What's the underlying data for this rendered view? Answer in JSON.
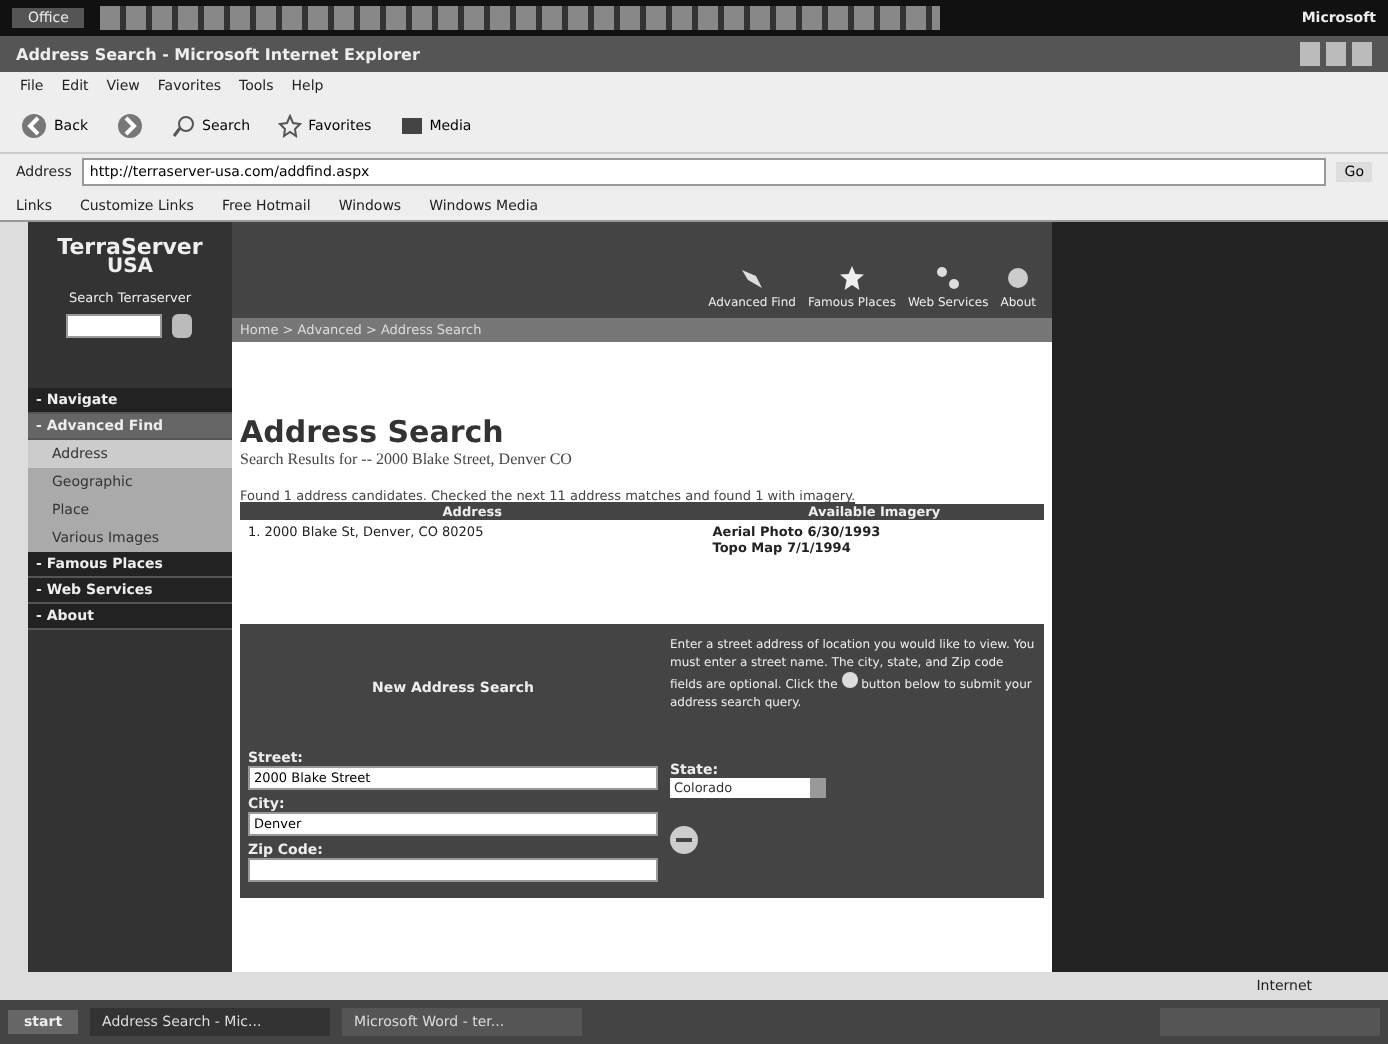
{
  "office_bar": {
    "label": "Office",
    "brand": "Microsoft"
  },
  "window": {
    "title": "Address Search - Microsoft Internet Explorer"
  },
  "menu": [
    "File",
    "Edit",
    "View",
    "Favorites",
    "Tools",
    "Help"
  ],
  "toolbar": [
    {
      "kind": "back",
      "label": "Back"
    },
    {
      "kind": "forward"
    },
    {
      "kind": "search",
      "label": "Search"
    },
    {
      "kind": "favorites",
      "label": "Favorites"
    },
    {
      "kind": "media",
      "label": "Media"
    }
  ],
  "address_bar": {
    "label": "Address",
    "value": "http://terraserver-usa.com/addfind.aspx",
    "go": "Go"
  },
  "links_bar": {
    "label": "Links",
    "items": [
      "Customize Links",
      "Free Hotmail",
      "Windows",
      "Windows Media"
    ]
  },
  "site": {
    "logo": "TerraServer",
    "logo_sub": "USA",
    "search_label": "Search Terraserver",
    "nav": [
      {
        "label": "- Navigate",
        "selected": false
      },
      {
        "label": "- Advanced Find",
        "selected": true,
        "children": [
          {
            "label": "Address",
            "selected": true
          },
          {
            "label": "Geographic",
            "selected": false
          },
          {
            "label": "Place",
            "selected": false
          },
          {
            "label": "Various Images",
            "selected": false
          }
        ]
      },
      {
        "label": "- Famous Places",
        "selected": false
      },
      {
        "label": "- Web Services",
        "selected": false
      },
      {
        "label": "- About",
        "selected": false
      }
    ],
    "top_links": [
      {
        "kind": "find",
        "label": "Advanced Find"
      },
      {
        "kind": "star",
        "label": "Famous Places"
      },
      {
        "kind": "services",
        "label": "Web Services"
      },
      {
        "kind": "about",
        "label": "About"
      }
    ],
    "breadcrumb": "Home > Advanced > Address Search",
    "heading": "Address Search",
    "subheading": "Search Results for -- 2000 Blake Street, Denver CO",
    "found": "Found 1 address candidates. Checked the next 11 address matches and found 1 with imagery.",
    "table": {
      "columns": [
        "Address",
        "Available Imagery"
      ],
      "rows": [
        {
          "address": "1. 2000 Blake St, Denver, CO 80205",
          "imagery": [
            "Aerial Photo 6/30/1993",
            "Topo Map 7/1/1994"
          ]
        }
      ]
    },
    "form": {
      "title": "New Address Search",
      "help_before": "Enter a street address of location you would like to view. You must enter a street name. The city, state, and Zip code fields are optional. Click the",
      "help_after": "button below to submit your address search query.",
      "street_label": "Street:",
      "street": "2000 Blake Street",
      "city_label": "City:",
      "city": "Denver",
      "state_label": "State:",
      "state": "Colorado",
      "zip_label": "Zip Code:"
    }
  },
  "status_bar": {
    "zone": "Internet"
  },
  "taskbar": {
    "start": "start",
    "tasks": [
      {
        "label": "Address Search - Mic...",
        "selected": true
      },
      {
        "label": "Microsoft Word - ter...",
        "selected": false
      }
    ]
  }
}
